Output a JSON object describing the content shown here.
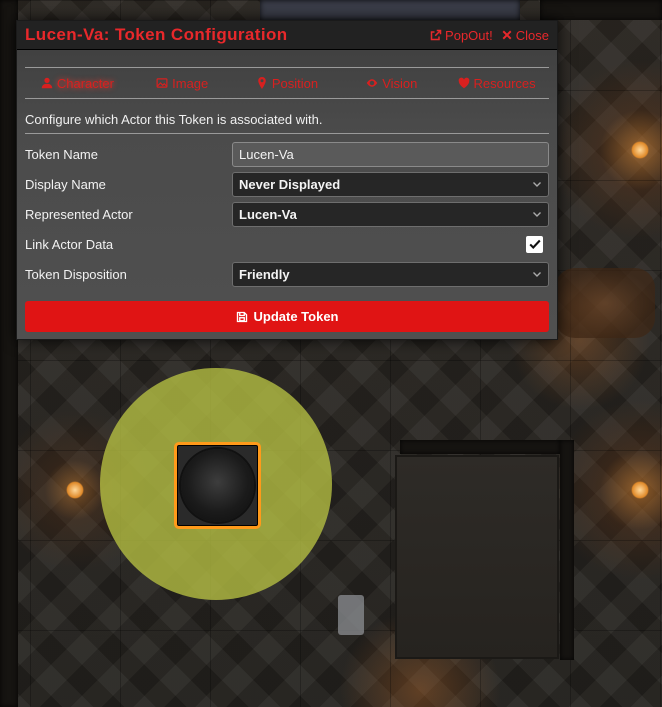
{
  "window": {
    "title": "Lucen-Va: Token Configuration",
    "popout_label": "PopOut!",
    "close_label": "Close"
  },
  "tabs": [
    {
      "label": "Character",
      "icon": "user-icon",
      "active": true
    },
    {
      "label": "Image",
      "icon": "image-icon",
      "active": false
    },
    {
      "label": "Position",
      "icon": "map-marker-icon",
      "active": false
    },
    {
      "label": "Vision",
      "icon": "eye-icon",
      "active": false
    },
    {
      "label": "Resources",
      "icon": "heart-icon",
      "active": false
    }
  ],
  "notes": "Configure which Actor this Token is associated with.",
  "form": {
    "token_name": {
      "label": "Token Name",
      "value": "Lucen-Va"
    },
    "display_name": {
      "label": "Display Name",
      "value": "Never Displayed"
    },
    "represented_actor": {
      "label": "Represented Actor",
      "value": "Lucen-Va"
    },
    "link_actor_data": {
      "label": "Link Actor Data",
      "checked": true
    },
    "token_disposition": {
      "label": "Token Disposition",
      "value": "Friendly"
    }
  },
  "submit": {
    "label": "Update Token",
    "icon": "save-icon"
  },
  "colors": {
    "accent": "#e8282b",
    "button": "#e01414",
    "token_border": "#ff9a1a",
    "vision_aura": "#b7c142"
  }
}
